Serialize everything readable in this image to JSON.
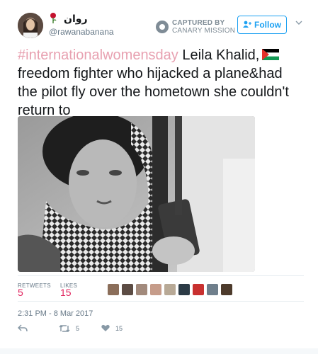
{
  "user": {
    "display_name": "روان",
    "screen_name": "@rawanabanana"
  },
  "watermark": {
    "line1": "CAPTURED BY",
    "line2": "CANARY MISSION"
  },
  "follow_label": "Follow",
  "tweet": {
    "hashtag": "#internationalwomensday",
    "text_after_hashtag": " Leila Khalid,",
    "text_rest": "freedom fighter who hijacked a plane&had the pilot fly over the hometown she couldn't return to"
  },
  "stats": {
    "retweets_label": "RETWEETS",
    "retweets_value": "5",
    "likes_label": "LIKES",
    "likes_value": "15"
  },
  "timestamp": "2:31 PM - 8 Mar 2017",
  "actions": {
    "retweet_count": "5",
    "like_count": "15"
  },
  "colors": {
    "accent": "#1da1f2",
    "hashtag": "#e8a1b1",
    "likes": "#e0245e"
  }
}
